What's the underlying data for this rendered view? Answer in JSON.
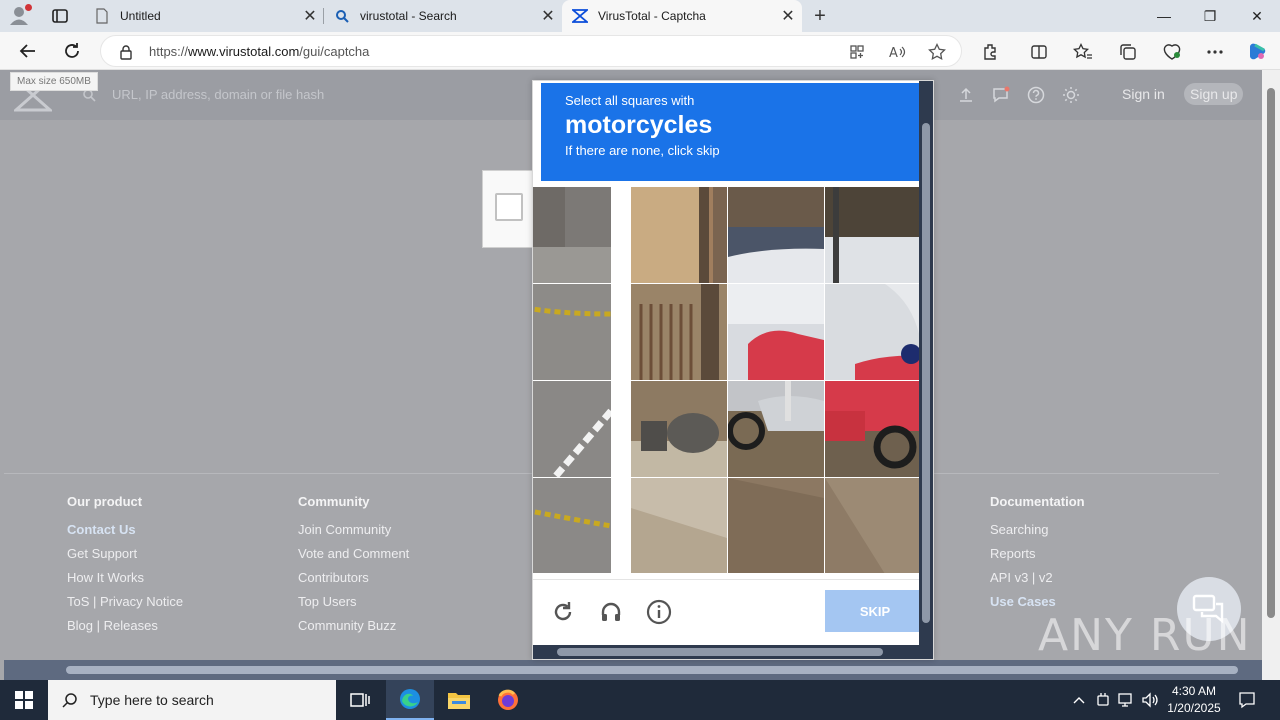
{
  "browser": {
    "tabs": [
      {
        "title": "Untitled",
        "close": "✕"
      },
      {
        "title": "virustotal - Search",
        "close": "✕"
      },
      {
        "title": "VirusTotal - Captcha",
        "close": "✕"
      }
    ],
    "new_tab": "+",
    "url_prefix": "https://",
    "url_host": "www.virustotal.com",
    "url_path": "/gui/captcha",
    "window_controls": {
      "minimize": "—",
      "maximize": "❐",
      "close": "✕"
    }
  },
  "page": {
    "max_size": "Max size 650MB",
    "search_placeholder": "URL, IP address, domain or file hash",
    "sign_in": "Sign in",
    "sign_up": "Sign up",
    "footer": {
      "columns": [
        {
          "heading": "Our product",
          "items": [
            "Contact Us",
            "Get Support",
            "How It Works",
            "ToS | Privacy Notice",
            "Blog | Releases"
          ]
        },
        {
          "heading": "Community",
          "items": [
            "Join Community",
            "Vote and Comment",
            "Contributors",
            "Top Users",
            "Community Buzz"
          ]
        },
        {
          "heading": "Documentation",
          "items": [
            "Searching",
            "Reports",
            "API v3 | v2",
            "Use Cases"
          ]
        }
      ]
    }
  },
  "captcha": {
    "instruction": "Select all squares with",
    "target": "motorcycles",
    "hint": "If there are none, click skip",
    "skip_label": "SKIP"
  },
  "watermark": "ANY RUN",
  "taskbar": {
    "search_placeholder": "Type here to search",
    "time": "4:30 AM",
    "date": "1/20/2025"
  }
}
